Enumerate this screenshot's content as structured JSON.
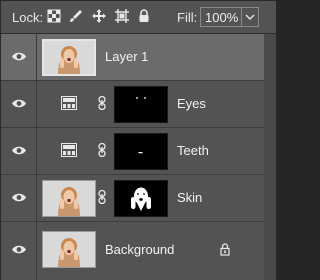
{
  "toolbar": {
    "lock_label": "Lock:",
    "fill_label": "Fill:",
    "fill_value": "100%",
    "lock_icons": [
      "lock-transparent-pixels-icon",
      "lock-image-pixels-icon",
      "lock-position-icon",
      "lock-artboard-icon",
      "lock-all-icon"
    ]
  },
  "layers": [
    {
      "name": "Layer 1",
      "type": "pixel",
      "selected": true,
      "visible": true
    },
    {
      "name": "Eyes",
      "type": "adjustment",
      "selected": false,
      "visible": true
    },
    {
      "name": "Teeth",
      "type": "adjustment",
      "selected": false,
      "visible": true
    },
    {
      "name": "Skin",
      "type": "pixel-with-mask",
      "selected": false,
      "visible": true
    },
    {
      "name": "Background",
      "type": "background",
      "locked": true,
      "selected": false,
      "visible": true
    }
  ],
  "colors": {
    "panel_bg": "#535353",
    "selected_row_bg": "#6b6b6b",
    "text": "#f2f2f2"
  }
}
